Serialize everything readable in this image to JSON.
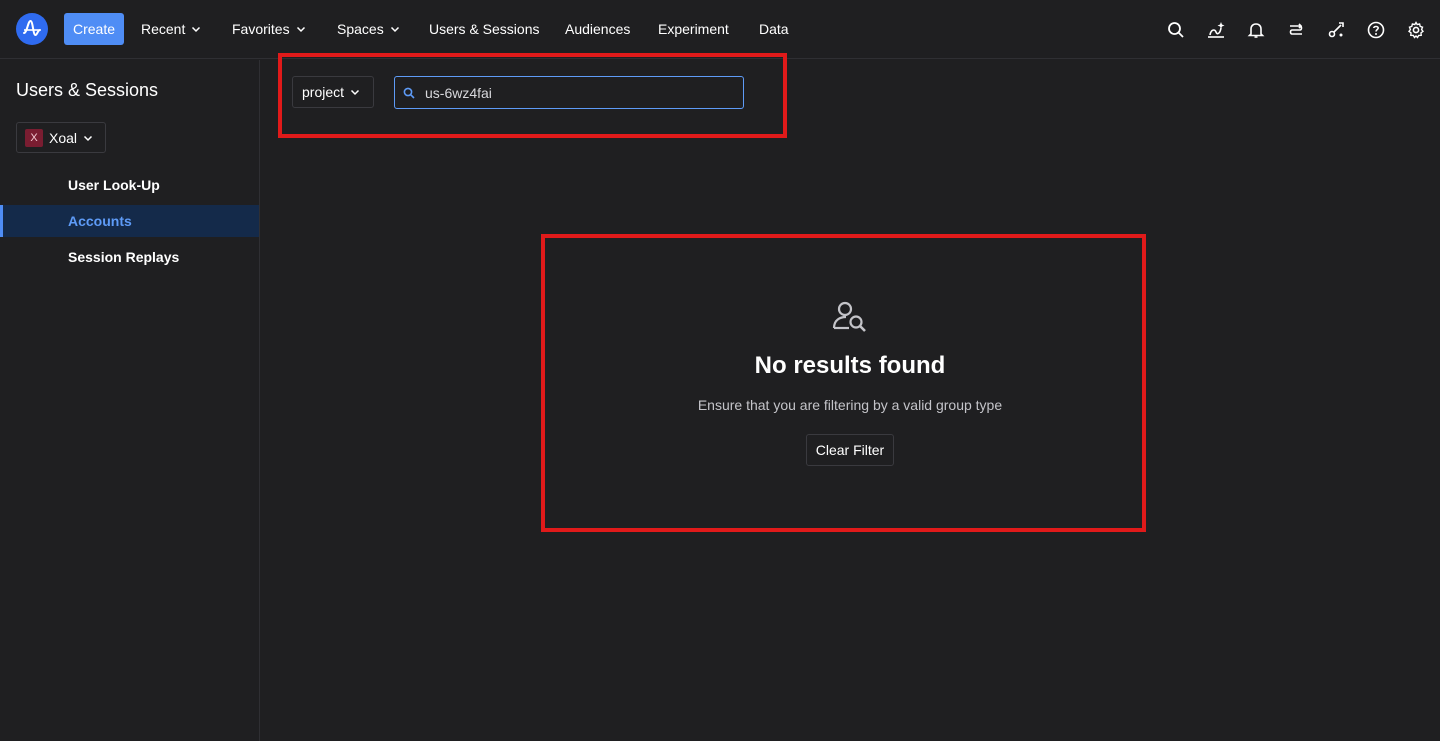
{
  "nav": {
    "create_label": "Create",
    "items": [
      {
        "label": "Recent",
        "dropdown": true
      },
      {
        "label": "Favorites",
        "dropdown": true
      },
      {
        "label": "Spaces",
        "dropdown": true
      },
      {
        "label": "Users & Sessions",
        "dropdown": false
      },
      {
        "label": "Audiences",
        "dropdown": false
      },
      {
        "label": "Experiment",
        "dropdown": false
      },
      {
        "label": "Data",
        "dropdown": false
      }
    ],
    "right_icons": [
      "search-icon",
      "sparkle-chart-icon",
      "bell-icon",
      "workflow-icon",
      "tools-icon",
      "help-icon",
      "settings-icon"
    ]
  },
  "sidebar": {
    "title": "Users & Sessions",
    "project": {
      "badge": "X",
      "name": "Xoal"
    },
    "items": [
      {
        "label": "User Look-Up",
        "active": false
      },
      {
        "label": "Accounts",
        "active": true
      },
      {
        "label": "Session Replays",
        "active": false
      }
    ]
  },
  "main": {
    "group_type": "project",
    "search_value": "us-6wz4fai",
    "empty_state": {
      "title": "No results found",
      "description": "Ensure that you are filtering by a valid group type",
      "button_label": "Clear Filter"
    }
  },
  "colors": {
    "accent": "#4f8df5",
    "highlight_border": "#e01a1a",
    "background": "#1f1f21"
  }
}
